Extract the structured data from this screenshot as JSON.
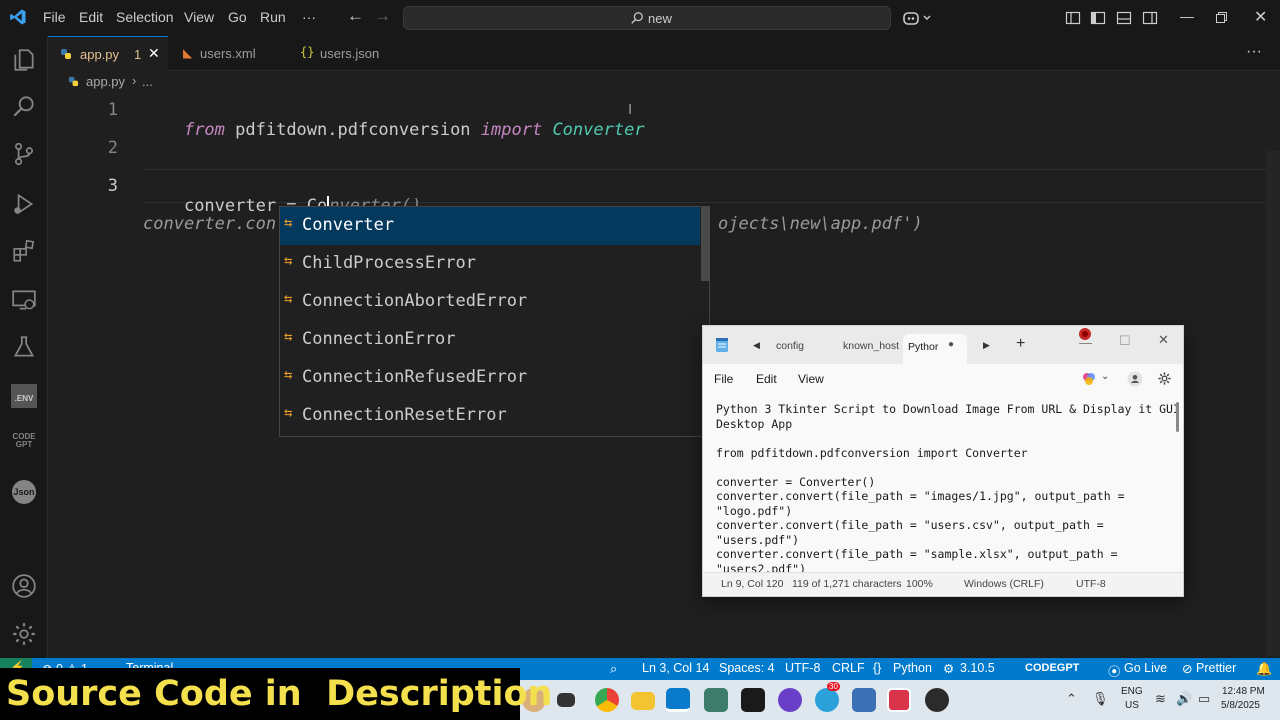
{
  "titlebar": {
    "menu": [
      "File",
      "Edit",
      "Selection",
      "View",
      "Go",
      "Run",
      "···"
    ],
    "search": "new"
  },
  "tabs": [
    {
      "label": "app.py",
      "badge": "1",
      "active": true
    },
    {
      "label": "users.xml",
      "active": false
    },
    {
      "label": "users.json",
      "active": false
    }
  ],
  "breadcrumb": {
    "file": "app.py",
    "rest": "..."
  },
  "editor": {
    "line_numbers": [
      "1",
      "2",
      "3"
    ],
    "line1": {
      "kw_from": "from",
      "module": " pdfitdown.pdfconversion ",
      "kw_import": "import",
      "cls": " Converter"
    },
    "line3": {
      "var": "converter = Co",
      "ghost": "nverter()"
    },
    "line4": {
      "start": "converter.con",
      "end": "ojects\\new\\app.pdf')"
    }
  },
  "suggestions": {
    "items": [
      "Converter",
      "ChildProcessError",
      "ConnectionAbortedError",
      "ConnectionError",
      "ConnectionRefusedError",
      "ConnectionResetError"
    ],
    "selected_index": 0
  },
  "notepad": {
    "tabs": [
      "config",
      "known_hosts",
      "Pythor"
    ],
    "menu": [
      "File",
      "Edit",
      "View"
    ],
    "lines": [
      "Python 3 Tkinter Script to Download Image From URL & Display it GUI",
      "Desktop App",
      "",
      "from pdfitdown.pdfconversion import Converter",
      "",
      "converter = Converter()",
      "converter.convert(file_path = \"images/1.jpg\", output_path =",
      "\"logo.pdf\")",
      "converter.convert(file_path = \"users.csv\", output_path =",
      "\"users.pdf\")",
      "converter.convert(file_path = \"sample.xlsx\", output_path =",
      "\"users2.pdf\")"
    ],
    "status": {
      "pos": "Ln 9, Col 120",
      "chars": "119 of 1,271 characters",
      "zoom": "100%",
      "eol": "Windows (CRLF)",
      "enc": "UTF-8"
    }
  },
  "statusbar": {
    "left": "⊗ 0 ⚠ 1",
    "terminal": "Terminal",
    "position": "Ln 3, Col 14",
    "spaces": "Spaces: 4",
    "encoding": "UTF-8",
    "eol": "CRLF",
    "language": "Python",
    "version": "3.10.5",
    "codegpt": "CODEGPT",
    "golive": "Go Live",
    "prettier": "Prettier"
  },
  "taskbar": {
    "lang": "ENG",
    "region": "US",
    "time": "12:48 PM",
    "date": "5/8/2025",
    "badge": "30"
  },
  "banner": "Source Code in  Description",
  "colors": {
    "accent": "#007acc",
    "keyword": "#c586c0",
    "class": "#4ec9b0",
    "selection": "#04395e"
  }
}
